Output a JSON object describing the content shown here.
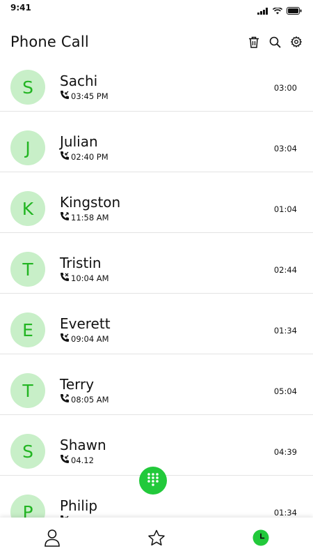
{
  "status_bar": {
    "time": "9:41"
  },
  "header": {
    "title": "Phone Call",
    "icons": [
      "trash-icon",
      "search-icon",
      "gear-icon"
    ]
  },
  "calls": [
    {
      "initial": "S",
      "name": "Sachi",
      "time": "03:45 PM",
      "duration": "03:00"
    },
    {
      "initial": "J",
      "name": "Julian",
      "time": "02:40 PM",
      "duration": "03:04"
    },
    {
      "initial": "K",
      "name": "Kingston",
      "time": "11:58 AM",
      "duration": "01:04"
    },
    {
      "initial": "T",
      "name": "Tristin",
      "time": "10:04 AM",
      "duration": "02:44"
    },
    {
      "initial": "E",
      "name": "Everett",
      "time": "09:04 AM",
      "duration": "01:34"
    },
    {
      "initial": "T",
      "name": "Terry",
      "time": "08:05 AM",
      "duration": "05:04"
    },
    {
      "initial": "S",
      "name": "Shawn",
      "time": "04.12",
      "duration": "04:39"
    },
    {
      "initial": "P",
      "name": "Philip",
      "time": "",
      "duration": "01:34"
    }
  ],
  "fab": {
    "icon": "dialpad-icon",
    "color": "#22c93b"
  },
  "bottom_nav": {
    "items": [
      "contacts-icon",
      "favorites-star-icon",
      "recents-clock-icon"
    ],
    "active": "recents-clock-icon",
    "accent": "#22c93b"
  },
  "colors": {
    "avatar_bg": "#c8efc8",
    "avatar_text": "#22b522"
  }
}
